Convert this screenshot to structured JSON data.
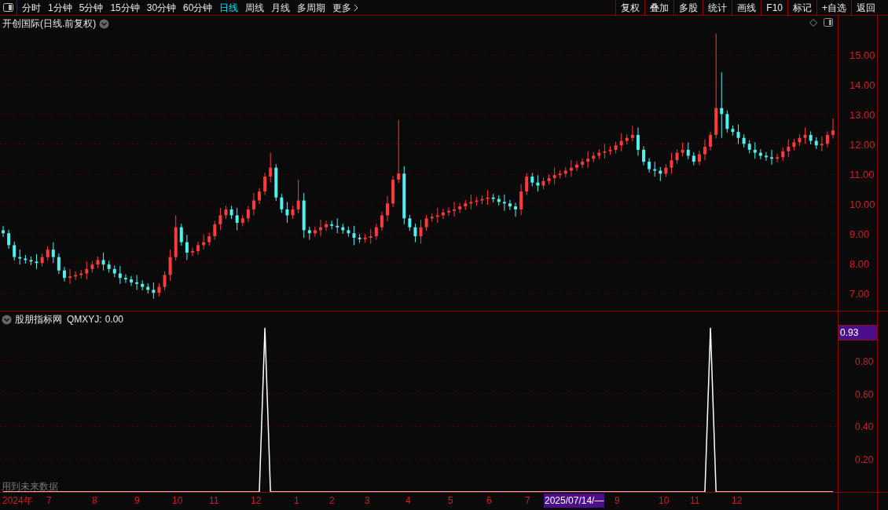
{
  "toolbar": {
    "periods": [
      {
        "label": "分时",
        "selected": false
      },
      {
        "label": "1分钟",
        "selected": false
      },
      {
        "label": "5分钟",
        "selected": false
      },
      {
        "label": "15分钟",
        "selected": false
      },
      {
        "label": "30分钟",
        "selected": false
      },
      {
        "label": "60分钟",
        "selected": false
      },
      {
        "label": "日线",
        "selected": true
      },
      {
        "label": "周线",
        "selected": false
      },
      {
        "label": "月线",
        "selected": false
      },
      {
        "label": "多周期",
        "selected": false
      },
      {
        "label": "更多",
        "selected": false
      }
    ],
    "actions": [
      "复权",
      "叠加",
      "多股",
      "统计",
      "画线",
      "F10",
      "标记",
      "+自选",
      "返回"
    ]
  },
  "main_chart": {
    "title": "开创国际(日线.前复权)",
    "chart_data": {
      "type": "candlestick",
      "grid": true,
      "ylim": [
        6.4,
        16.3
      ],
      "yticks": [
        {
          "value": 15,
          "label": "15.00"
        },
        {
          "value": 14,
          "label": "14.00"
        },
        {
          "value": 13,
          "label": "13.00"
        },
        {
          "value": 12,
          "label": "12.00"
        },
        {
          "value": 11,
          "label": "11.00"
        },
        {
          "value": 10,
          "label": "10.00"
        },
        {
          "value": 9,
          "label": "9.00"
        },
        {
          "value": 8,
          "label": "8.00"
        },
        {
          "value": 7,
          "label": "7.00"
        }
      ],
      "ohlc": [
        [
          9.1,
          9.25,
          8.88,
          9.0
        ],
        [
          9.0,
          9.12,
          8.48,
          8.6
        ],
        [
          8.6,
          8.72,
          8.08,
          8.2
        ],
        [
          8.2,
          8.45,
          7.95,
          8.15
        ],
        [
          8.15,
          8.27,
          7.98,
          8.1
        ],
        [
          8.1,
          8.22,
          7.93,
          8.05
        ],
        [
          8.05,
          8.3,
          7.8,
          8.0
        ],
        [
          8.0,
          8.32,
          7.88,
          8.2
        ],
        [
          8.2,
          8.57,
          8.08,
          8.45
        ],
        [
          8.45,
          8.7,
          8.0,
          8.2
        ],
        [
          8.2,
          8.32,
          7.63,
          7.75
        ],
        [
          7.75,
          7.87,
          7.38,
          7.5
        ],
        [
          7.5,
          7.8,
          7.3,
          7.55
        ],
        [
          7.55,
          7.72,
          7.43,
          7.6
        ],
        [
          7.6,
          7.77,
          7.48,
          7.65
        ],
        [
          7.65,
          8.05,
          7.45,
          7.8
        ],
        [
          7.8,
          8.07,
          7.68,
          7.95
        ],
        [
          7.95,
          8.22,
          7.83,
          8.1
        ],
        [
          8.1,
          8.35,
          7.75,
          7.95
        ],
        [
          7.95,
          8.07,
          7.68,
          7.8
        ],
        [
          7.8,
          7.92,
          7.53,
          7.65
        ],
        [
          7.65,
          7.9,
          7.3,
          7.5
        ],
        [
          7.5,
          7.62,
          7.33,
          7.45
        ],
        [
          7.45,
          7.57,
          7.23,
          7.35
        ],
        [
          7.35,
          7.6,
          7.1,
          7.3
        ],
        [
          7.3,
          7.42,
          7.08,
          7.2
        ],
        [
          7.2,
          7.32,
          6.98,
          7.1
        ],
        [
          7.1,
          7.35,
          6.8,
          7.0
        ],
        [
          7.0,
          7.32,
          6.88,
          7.2
        ],
        [
          7.2,
          7.72,
          7.08,
          7.6
        ],
        [
          7.6,
          8.45,
          7.4,
          8.2
        ],
        [
          8.2,
          9.6,
          8.08,
          9.2
        ],
        [
          9.2,
          9.32,
          8.58,
          8.7
        ],
        [
          8.7,
          8.95,
          8.1,
          8.35
        ],
        [
          8.35,
          8.52,
          8.23,
          8.4
        ],
        [
          8.4,
          8.72,
          8.28,
          8.6
        ],
        [
          8.6,
          8.95,
          8.45,
          8.7
        ],
        [
          8.7,
          9.02,
          8.58,
          8.9
        ],
        [
          8.9,
          9.42,
          8.78,
          9.3
        ],
        [
          9.3,
          9.85,
          9.1,
          9.6
        ],
        [
          9.6,
          9.92,
          9.48,
          9.8
        ],
        [
          9.8,
          9.92,
          9.48,
          9.6
        ],
        [
          9.6,
          9.85,
          9.1,
          9.35
        ],
        [
          9.35,
          9.62,
          9.23,
          9.5
        ],
        [
          9.5,
          9.92,
          9.38,
          9.8
        ],
        [
          9.8,
          10.35,
          9.6,
          10.1
        ],
        [
          10.1,
          10.52,
          9.98,
          10.4
        ],
        [
          10.4,
          11.02,
          10.28,
          10.9
        ],
        [
          10.9,
          11.7,
          10.7,
          11.2
        ],
        [
          11.2,
          11.32,
          10.08,
          10.2
        ],
        [
          10.2,
          10.32,
          9.68,
          9.8
        ],
        [
          9.8,
          10.05,
          9.35,
          9.6
        ],
        [
          9.6,
          9.92,
          9.48,
          9.8
        ],
        [
          9.8,
          10.8,
          9.68,
          10.1
        ],
        [
          10.1,
          10.35,
          8.85,
          9.1
        ],
        [
          9.1,
          9.22,
          8.78,
          9.0
        ],
        [
          9.0,
          9.22,
          8.88,
          9.1
        ],
        [
          9.1,
          9.45,
          8.9,
          9.2
        ],
        [
          9.2,
          9.42,
          9.08,
          9.3
        ],
        [
          9.3,
          9.42,
          9.13,
          9.25
        ],
        [
          9.25,
          9.5,
          9.0,
          9.2
        ],
        [
          9.2,
          9.32,
          8.98,
          9.1
        ],
        [
          9.1,
          9.22,
          8.88,
          9.0
        ],
        [
          9.0,
          9.25,
          8.6,
          8.85
        ],
        [
          8.85,
          8.97,
          8.68,
          8.8
        ],
        [
          8.8,
          8.97,
          8.68,
          8.85
        ],
        [
          8.85,
          9.15,
          8.65,
          8.9
        ],
        [
          8.9,
          9.32,
          8.78,
          9.2
        ],
        [
          9.2,
          9.72,
          9.08,
          9.6
        ],
        [
          9.6,
          10.25,
          9.4,
          10.0
        ],
        [
          10.0,
          10.92,
          9.88,
          10.8
        ],
        [
          10.8,
          12.8,
          10.68,
          11.0
        ],
        [
          11.0,
          11.25,
          9.3,
          9.5
        ],
        [
          9.5,
          9.62,
          9.08,
          9.2
        ],
        [
          9.2,
          9.32,
          8.7,
          8.9
        ],
        [
          8.9,
          9.45,
          8.65,
          9.2
        ],
        [
          9.2,
          9.62,
          9.08,
          9.5
        ],
        [
          9.5,
          9.67,
          9.38,
          9.55
        ],
        [
          9.55,
          9.85,
          9.35,
          9.6
        ],
        [
          9.6,
          9.82,
          9.48,
          9.7
        ],
        [
          9.7,
          9.87,
          9.58,
          9.75
        ],
        [
          9.75,
          10.05,
          9.55,
          9.8
        ],
        [
          9.8,
          10.02,
          9.68,
          9.9
        ],
        [
          9.9,
          10.12,
          9.78,
          10.0
        ],
        [
          10.0,
          10.3,
          9.8,
          10.05
        ],
        [
          10.05,
          10.22,
          9.93,
          10.1
        ],
        [
          10.1,
          10.27,
          9.98,
          10.15
        ],
        [
          10.15,
          10.45,
          9.95,
          10.2
        ],
        [
          10.2,
          10.32,
          10.03,
          10.15
        ],
        [
          10.15,
          10.27,
          9.93,
          10.05
        ],
        [
          10.05,
          10.3,
          9.75,
          10.0
        ],
        [
          10.0,
          10.12,
          9.78,
          9.9
        ],
        [
          9.9,
          10.02,
          9.55,
          9.8
        ],
        [
          9.8,
          10.65,
          9.6,
          10.4
        ],
        [
          10.4,
          11.02,
          10.28,
          10.9
        ],
        [
          10.9,
          11.02,
          10.58,
          10.7
        ],
        [
          10.7,
          10.95,
          10.4,
          10.6
        ],
        [
          10.6,
          10.87,
          10.48,
          10.75
        ],
        [
          10.75,
          10.97,
          10.63,
          10.85
        ],
        [
          10.85,
          11.2,
          10.65,
          10.95
        ],
        [
          10.95,
          11.12,
          10.83,
          11.0
        ],
        [
          11.0,
          11.22,
          10.88,
          11.1
        ],
        [
          11.1,
          11.45,
          10.9,
          11.2
        ],
        [
          11.2,
          11.42,
          11.08,
          11.3
        ],
        [
          11.3,
          11.52,
          11.18,
          11.4
        ],
        [
          11.4,
          11.75,
          11.2,
          11.5
        ],
        [
          11.5,
          11.72,
          11.38,
          11.6
        ],
        [
          11.6,
          11.82,
          11.48,
          11.7
        ],
        [
          11.7,
          12.0,
          11.5,
          11.75
        ],
        [
          11.75,
          11.92,
          11.63,
          11.8
        ],
        [
          11.8,
          12.07,
          11.68,
          11.95
        ],
        [
          11.95,
          12.35,
          11.75,
          12.1
        ],
        [
          12.1,
          12.32,
          11.98,
          12.2
        ],
        [
          12.2,
          12.6,
          12.08,
          12.3
        ],
        [
          12.3,
          12.55,
          11.6,
          11.8
        ],
        [
          11.8,
          11.92,
          11.28,
          11.4
        ],
        [
          11.4,
          11.52,
          11.03,
          11.15
        ],
        [
          11.15,
          11.4,
          10.9,
          11.1
        ],
        [
          11.1,
          11.22,
          10.75,
          11.0
        ],
        [
          11.0,
          11.32,
          10.88,
          11.2
        ],
        [
          11.2,
          11.7,
          11.0,
          11.45
        ],
        [
          11.45,
          11.82,
          11.33,
          11.7
        ],
        [
          11.7,
          12.05,
          11.58,
          11.8
        ],
        [
          11.8,
          12.05,
          11.48,
          11.6
        ],
        [
          11.6,
          11.72,
          11.28,
          11.4
        ],
        [
          11.4,
          11.77,
          11.28,
          11.65
        ],
        [
          11.65,
          12.15,
          11.45,
          11.9
        ],
        [
          11.9,
          12.42,
          11.78,
          12.3
        ],
        [
          12.3,
          15.7,
          12.18,
          13.2
        ],
        [
          13.2,
          14.4,
          12.2,
          13.0
        ],
        [
          13.0,
          13.12,
          12.38,
          12.5
        ],
        [
          12.5,
          12.62,
          12.28,
          12.4
        ],
        [
          12.4,
          12.65,
          12.0,
          12.2
        ],
        [
          12.2,
          12.32,
          11.88,
          12.0
        ],
        [
          12.0,
          12.12,
          11.68,
          11.8
        ],
        [
          11.8,
          12.05,
          11.5,
          11.7
        ],
        [
          11.7,
          11.82,
          11.48,
          11.6
        ],
        [
          11.6,
          11.72,
          11.43,
          11.55
        ],
        [
          11.55,
          11.8,
          11.3,
          11.5
        ],
        [
          11.5,
          11.67,
          11.38,
          11.55
        ],
        [
          11.55,
          11.87,
          11.43,
          11.75
        ],
        [
          11.75,
          12.15,
          11.55,
          11.9
        ],
        [
          11.9,
          12.17,
          11.78,
          12.05
        ],
        [
          12.05,
          12.32,
          11.93,
          12.2
        ],
        [
          12.2,
          12.55,
          12.0,
          12.3
        ],
        [
          12.3,
          12.42,
          11.98,
          12.1
        ],
        [
          12.1,
          12.22,
          11.83,
          11.95
        ],
        [
          11.95,
          12.25,
          11.75,
          12.0
        ],
        [
          12.0,
          12.42,
          11.88,
          12.3
        ],
        [
          12.3,
          12.85,
          12.18,
          12.45
        ]
      ]
    }
  },
  "indicator": {
    "name": "股朋指标网",
    "reading_value": "0.00",
    "current_value": "0.93",
    "note": "用到未来数据",
    "chart_data": {
      "type": "line",
      "grid": true,
      "series": [
        {
          "name": "QMXYJ:",
          "color": "#ffffff",
          "values": [
            0,
            0,
            0,
            0,
            0,
            0,
            0,
            0,
            0,
            0,
            0,
            0,
            0,
            0,
            0,
            0,
            0,
            0,
            0,
            0,
            0,
            0,
            0,
            0,
            0,
            0,
            0,
            0,
            0,
            0,
            0,
            0,
            0,
            0,
            0,
            0,
            0,
            0,
            0,
            0,
            0,
            0,
            0,
            0,
            0,
            0,
            0,
            1,
            0,
            0,
            0,
            0,
            0,
            0,
            0,
            0,
            0,
            0,
            0,
            0,
            0,
            0,
            0,
            0,
            0,
            0,
            0,
            0,
            0,
            0,
            0,
            0,
            0,
            0,
            0,
            0,
            0,
            0,
            0,
            0,
            0,
            0,
            0,
            0,
            0,
            0,
            0,
            0,
            0,
            0,
            0,
            0,
            0,
            0,
            0,
            0,
            0,
            0,
            0,
            0,
            0,
            0,
            0,
            0,
            0,
            0,
            0,
            0,
            0,
            0,
            0,
            0,
            0,
            0,
            0,
            0,
            0,
            0,
            0,
            0,
            0,
            0,
            0,
            0,
            0,
            0,
            0,
            1,
            0,
            0,
            0,
            0,
            0,
            0,
            0,
            0,
            0,
            0,
            0,
            0,
            0,
            0,
            0,
            0,
            0,
            0,
            0,
            0,
            0,
            0
          ]
        }
      ],
      "ylim": [
        0,
        1.1
      ],
      "yticks": [
        {
          "value": 0.8,
          "label": "0.80"
        },
        {
          "value": 0.6,
          "label": "0.60"
        },
        {
          "value": 0.4,
          "label": "0.40"
        },
        {
          "value": 0.2,
          "label": "0.20"
        }
      ]
    }
  },
  "time_axis": [
    {
      "label": "2024年",
      "selected": false
    },
    {
      "label": "7",
      "selected": false
    },
    {
      "label": "8",
      "selected": false
    },
    {
      "label": "9",
      "selected": false
    },
    {
      "label": "10",
      "selected": false
    },
    {
      "label": "11",
      "selected": false
    },
    {
      "label": "12",
      "selected": false
    },
    {
      "label": "1",
      "selected": false
    },
    {
      "label": "2",
      "selected": false
    },
    {
      "label": "3",
      "selected": false
    },
    {
      "label": "4",
      "selected": false
    },
    {
      "label": "5",
      "selected": false
    },
    {
      "label": "6",
      "selected": false
    },
    {
      "label": "7",
      "selected": false
    },
    {
      "label": "2025/07/14/—",
      "selected": true
    },
    {
      "label": "9",
      "selected": false
    },
    {
      "label": "10",
      "selected": false
    },
    {
      "label": "11",
      "selected": false
    },
    {
      "label": "12",
      "selected": false
    }
  ]
}
